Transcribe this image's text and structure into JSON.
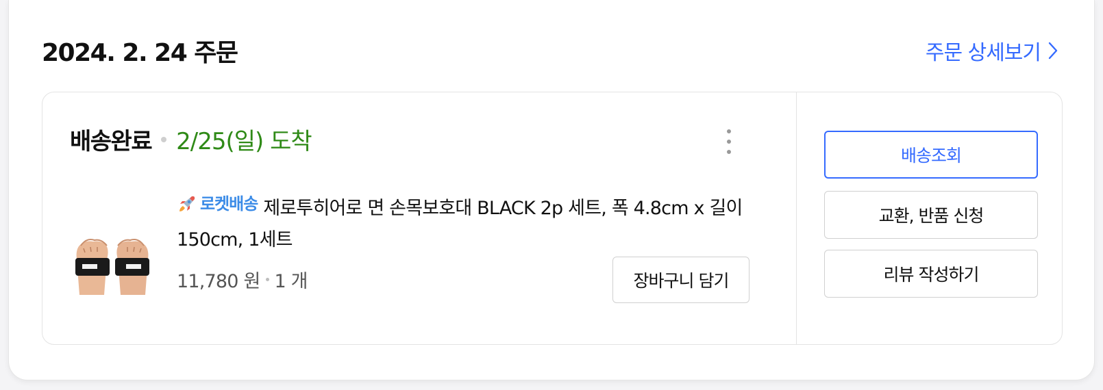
{
  "order": {
    "date_title": "2024. 2. 24 주문",
    "detail_link": "주문 상세보기"
  },
  "item": {
    "status": "배송완료",
    "arrival": "2/25(일) 도착",
    "badge": "로켓배송",
    "product_name": "제로투히어로 면 손목보호대 BLACK 2p 세트, 폭 4.8cm x 길이 150cm, 1세트",
    "price": "11,780 원",
    "quantity": "1 개",
    "cart_button": "장바구니 담기"
  },
  "actions": {
    "track": "배송조회",
    "exchange_return": "교환, 반품 신청",
    "write_review": "리뷰 작성하기"
  },
  "icons": {
    "detail_chevron": "chevron-right-icon",
    "more": "more-vertical-icon",
    "rocket": "rocket-icon"
  },
  "colors": {
    "accent_blue": "#346aff",
    "arrival_green": "#2f8a17",
    "rocket_blue": "#3c8ce7"
  }
}
